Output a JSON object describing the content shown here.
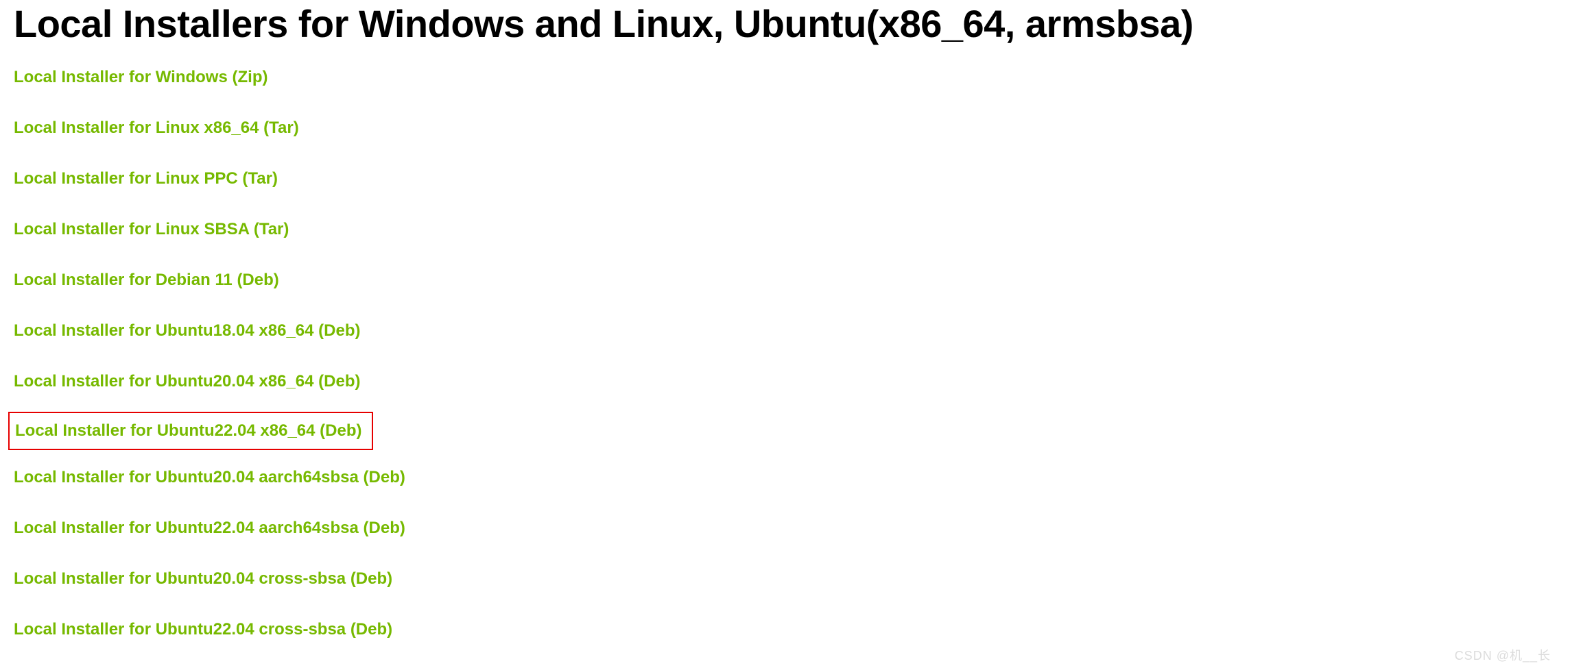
{
  "heading": "Local Installers for Windows and Linux, Ubuntu(x86_64, armsbsa)",
  "links": [
    {
      "label": "Local Installer for Windows (Zip)",
      "highlighted": false
    },
    {
      "label": "Local Installer for Linux x86_64 (Tar)",
      "highlighted": false
    },
    {
      "label": "Local Installer for Linux PPC (Tar)",
      "highlighted": false
    },
    {
      "label": "Local Installer for Linux SBSA (Tar)",
      "highlighted": false
    },
    {
      "label": "Local Installer for Debian 11 (Deb)",
      "highlighted": false
    },
    {
      "label": "Local Installer for Ubuntu18.04 x86_64 (Deb)",
      "highlighted": false
    },
    {
      "label": "Local Installer for Ubuntu20.04 x86_64 (Deb)",
      "highlighted": false
    },
    {
      "label": "Local Installer for Ubuntu22.04 x86_64 (Deb)",
      "highlighted": true
    },
    {
      "label": "Local Installer for Ubuntu20.04 aarch64sbsa (Deb)",
      "highlighted": false
    },
    {
      "label": "Local Installer for Ubuntu22.04 aarch64sbsa (Deb)",
      "highlighted": false
    },
    {
      "label": "Local Installer for Ubuntu20.04 cross-sbsa (Deb)",
      "highlighted": false
    },
    {
      "label": "Local Installer for Ubuntu22.04 cross-sbsa (Deb)",
      "highlighted": false
    }
  ],
  "watermark": "CSDN @机__长"
}
